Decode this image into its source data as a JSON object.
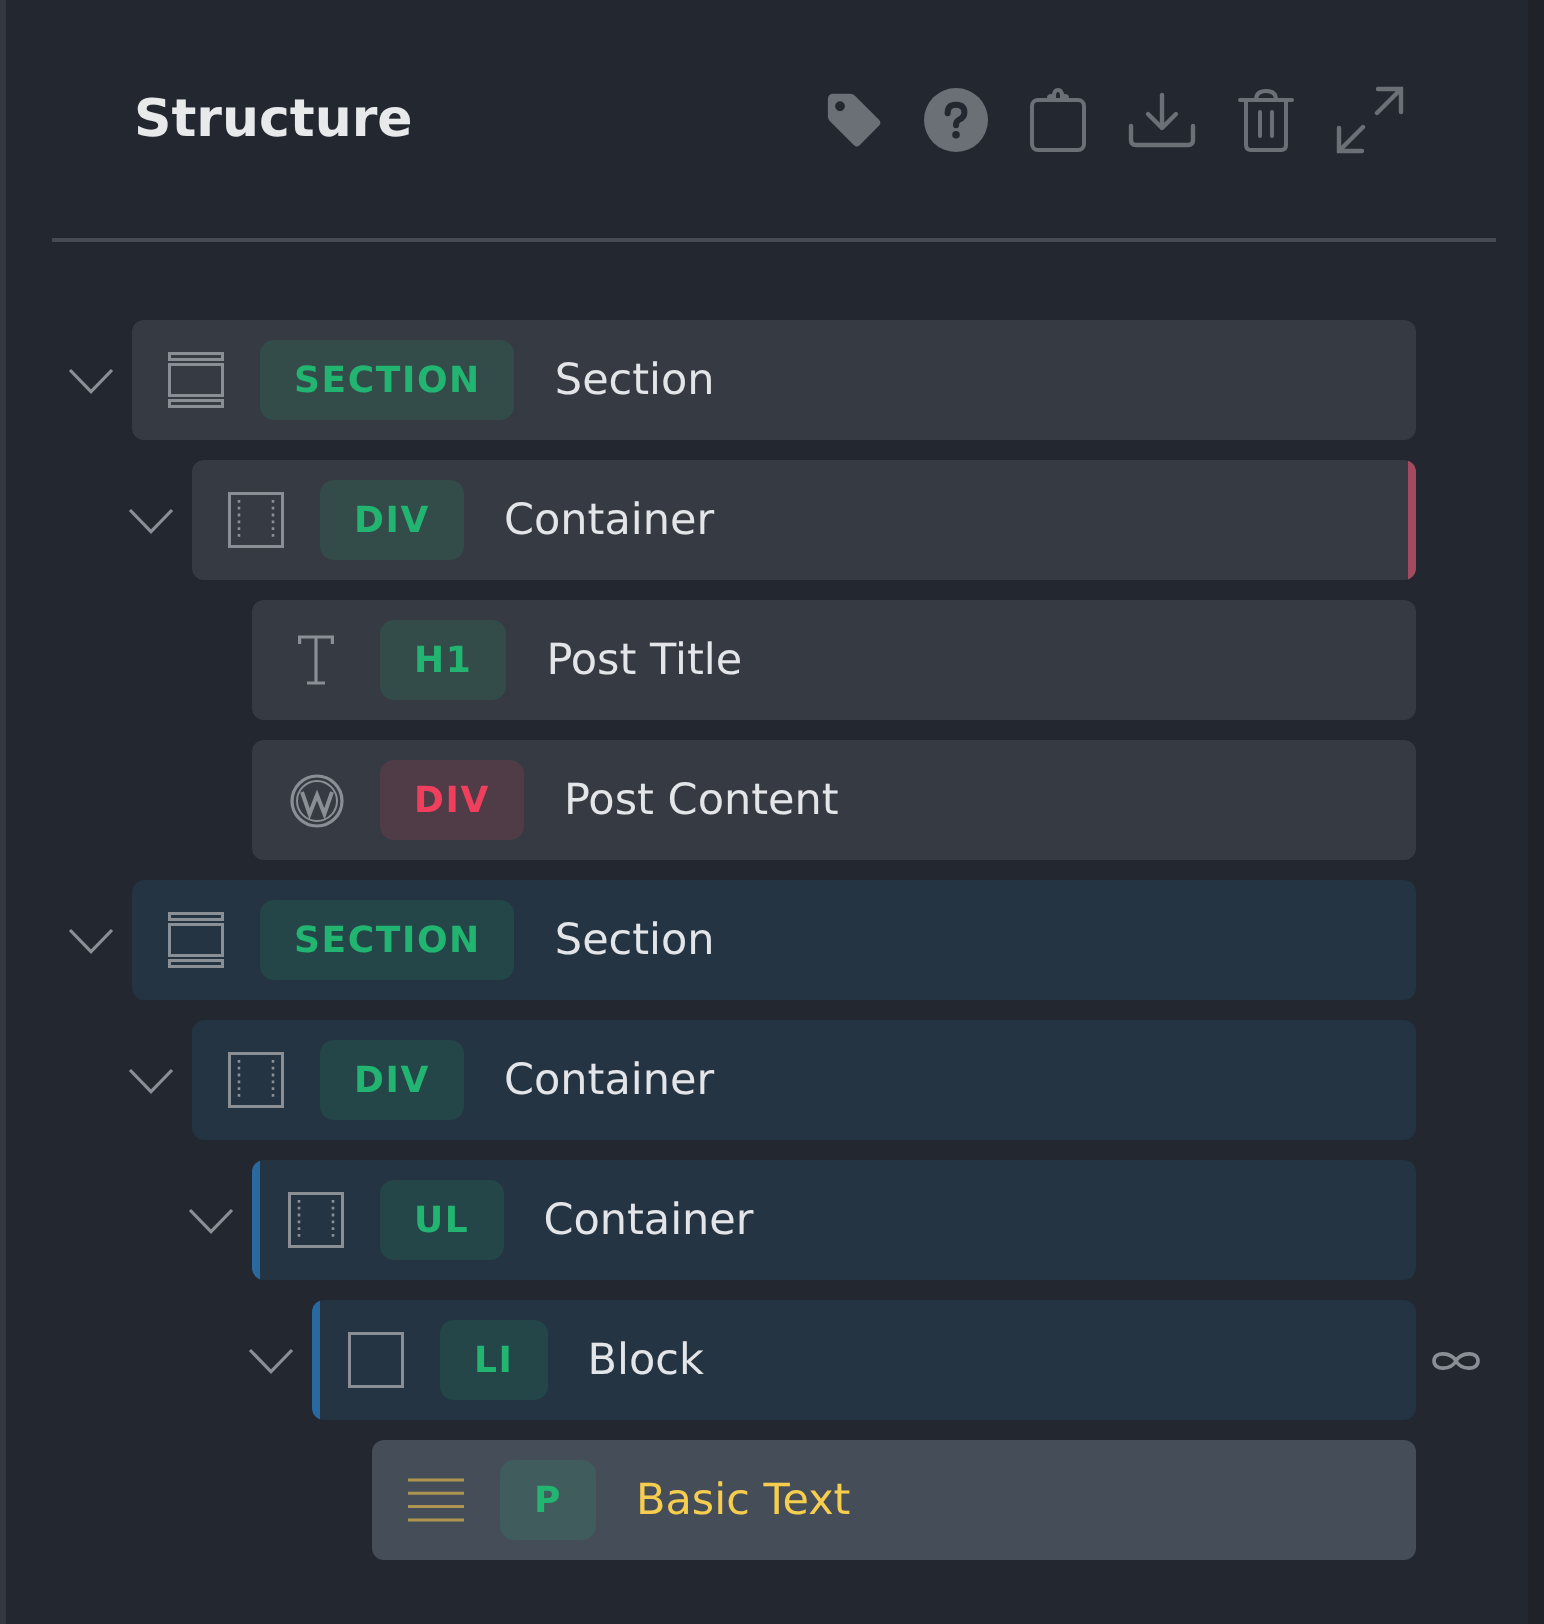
{
  "header": {
    "title": "Structure"
  },
  "tree": [
    {
      "kind": "section",
      "tag": {
        "label": "SECTION",
        "color": "#22b571"
      },
      "label": "Section",
      "expanded": true,
      "selected": false,
      "loop": false,
      "children": [
        {
          "kind": "container",
          "tag": {
            "label": "DIV",
            "color": "#22b571"
          },
          "label": "Container",
          "expanded": true,
          "selected": false,
          "loop": false,
          "right_bar": {
            "color": "#a34a60"
          },
          "children": [
            {
              "kind": "heading",
              "tag": {
                "label": "H1",
                "color": "#22b571"
              },
              "label": "Post Title",
              "selected": false,
              "loop": false
            },
            {
              "kind": "post-content",
              "tag": {
                "label": "DIV",
                "color": "#f03f5d"
              },
              "label": "Post Content",
              "selected": false,
              "loop": false
            }
          ]
        }
      ]
    },
    {
      "kind": "section",
      "tag": {
        "label": "SECTION",
        "color": "#22b571"
      },
      "label": "Section",
      "expanded": true,
      "selected": false,
      "loop": false,
      "children": [
        {
          "kind": "container",
          "tag": {
            "label": "DIV",
            "color": "#22b571"
          },
          "label": "Container",
          "expanded": true,
          "selected": false,
          "loop": false,
          "children": [
            {
              "kind": "container",
              "tag": {
                "label": "UL",
                "color": "#22b571"
              },
              "label": "Container",
              "expanded": true,
              "selected": false,
              "loop": false,
              "left_bar": {
                "color": "#2a69a0"
              },
              "children": [
                {
                  "kind": "block",
                  "tag": {
                    "label": "LI",
                    "color": "#22b571"
                  },
                  "label": "Block",
                  "expanded": true,
                  "selected": false,
                  "loop": true,
                  "left_bar": {
                    "color": "#2a69a0"
                  },
                  "children": [
                    {
                      "kind": "text",
                      "tag": {
                        "label": "P",
                        "color": "#22b571"
                      },
                      "label": "Basic Text",
                      "selected": true,
                      "loop": false
                    }
                  ]
                }
              ]
            }
          ]
        }
      ]
    }
  ]
}
